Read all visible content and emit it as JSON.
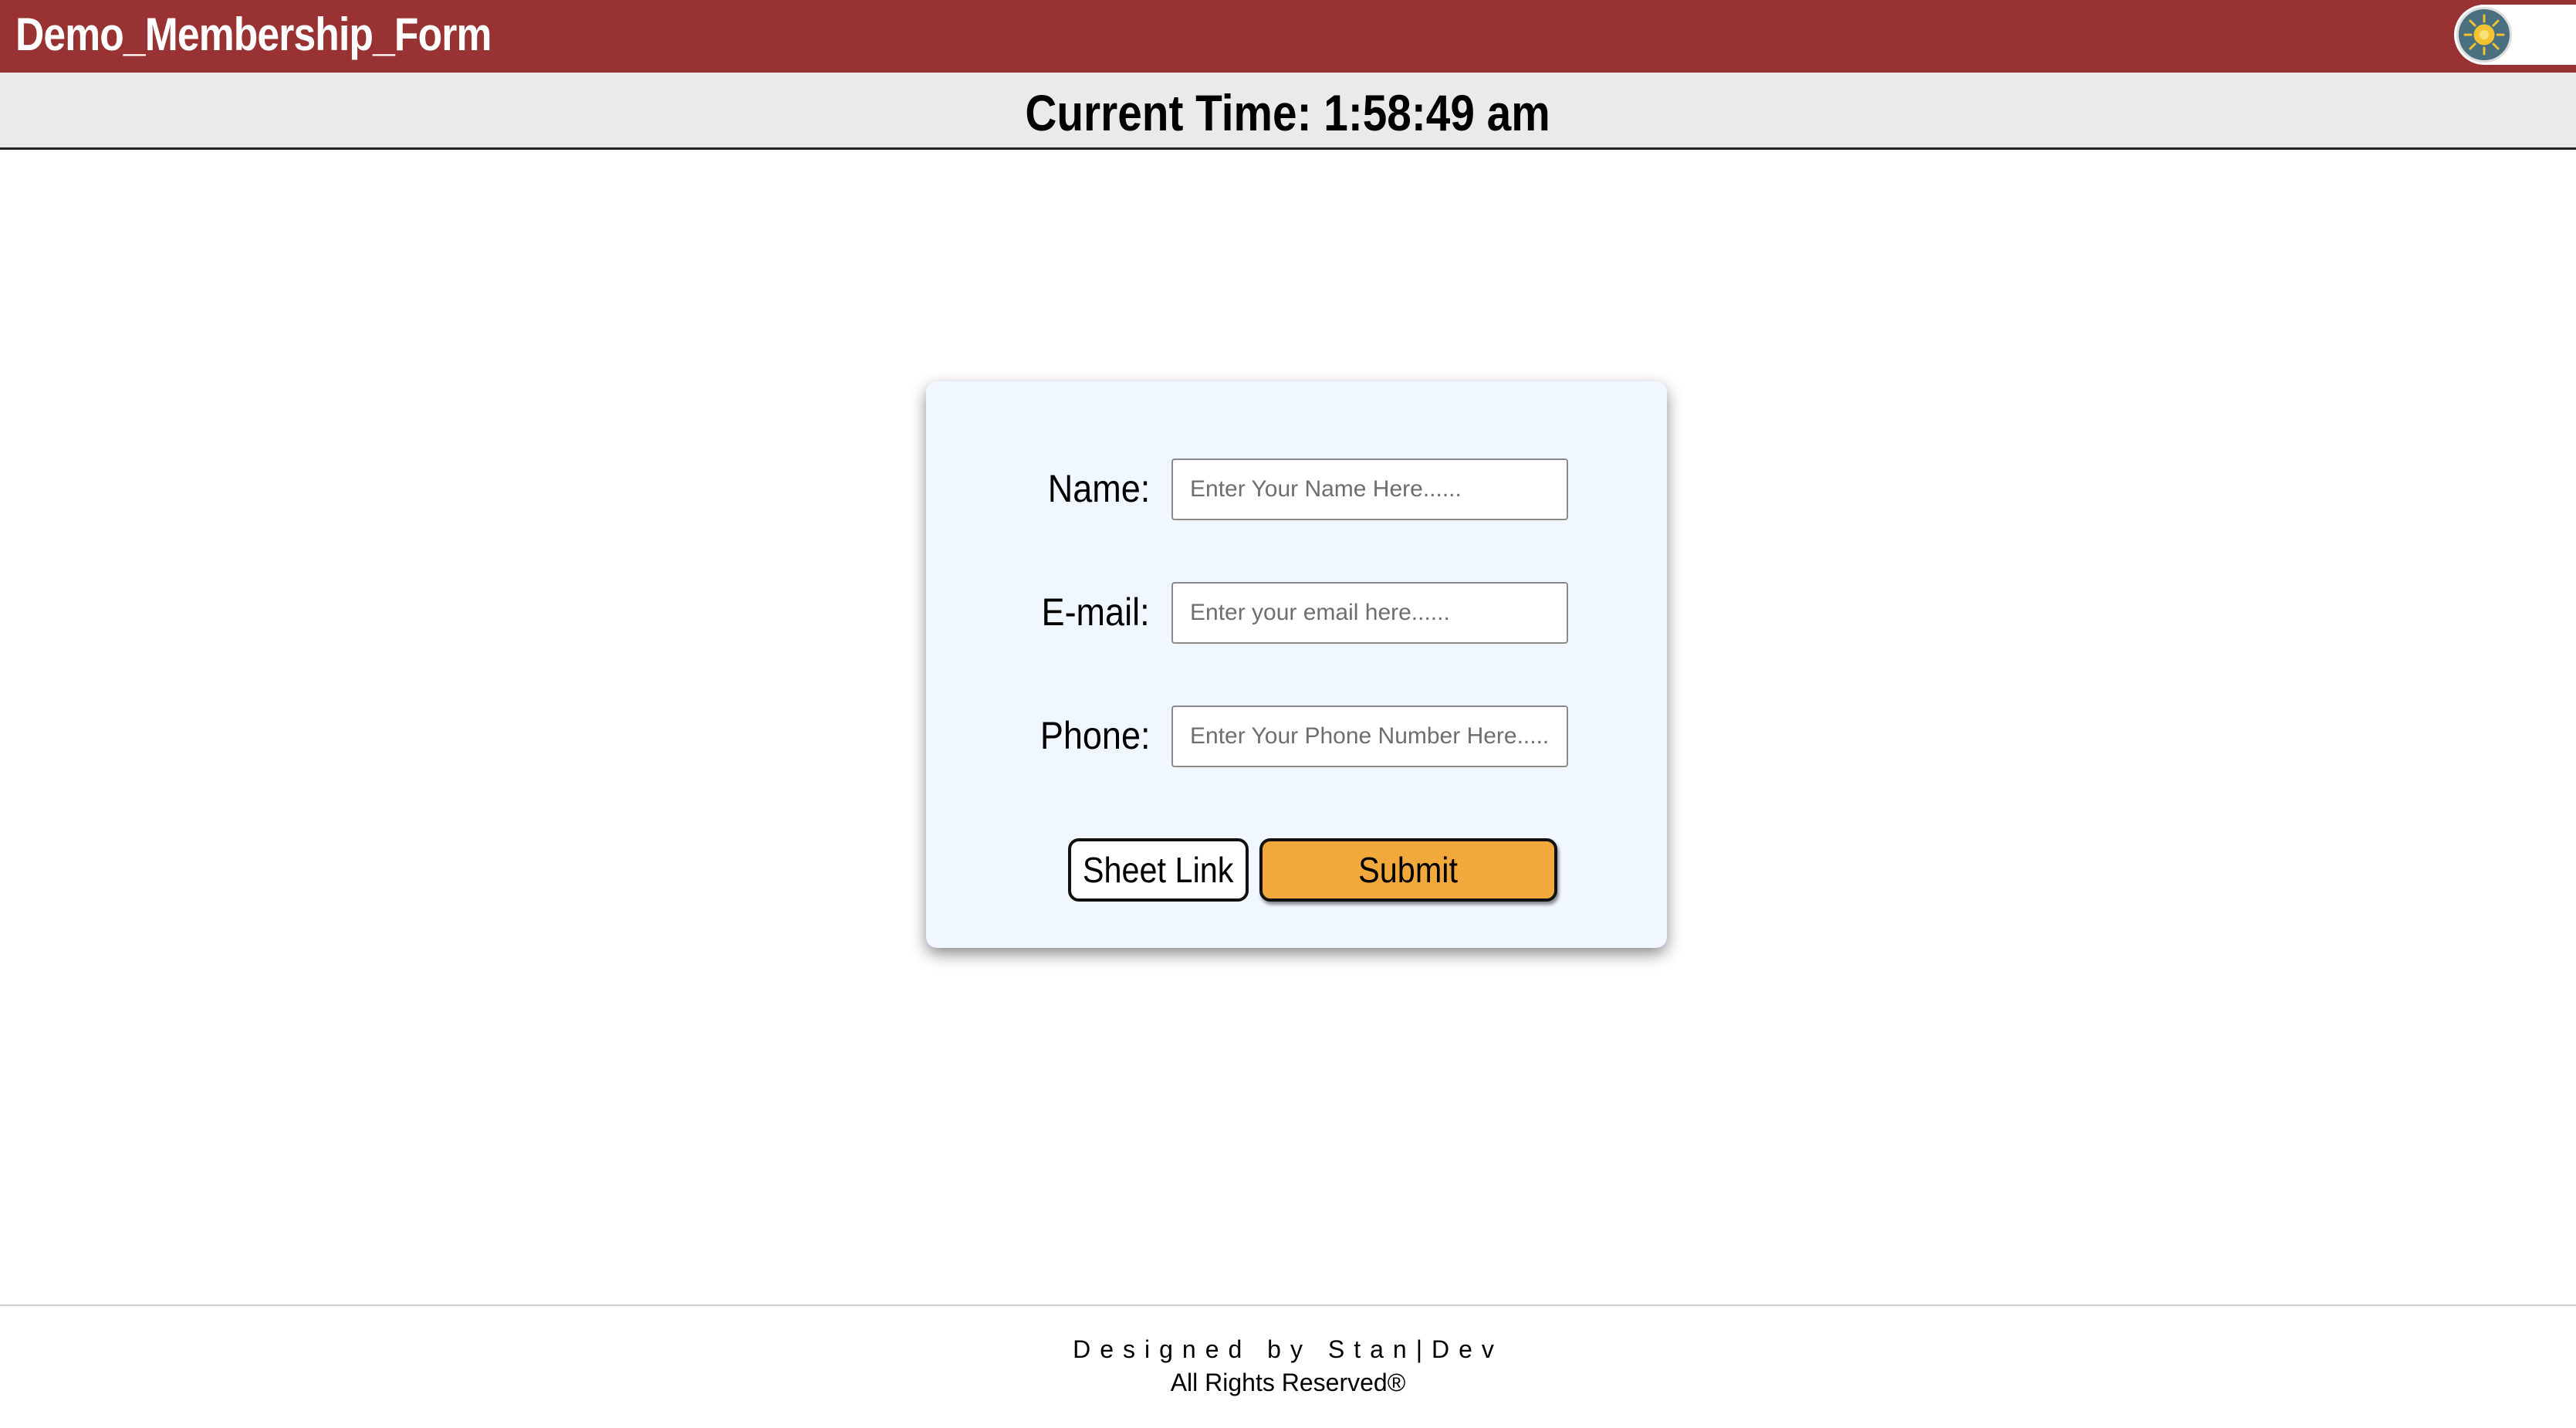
{
  "header": {
    "title": "Demo_Membership_Form",
    "theme_toggle_icon": "sun-icon",
    "theme_toggle_color": "#993232"
  },
  "time_bar": {
    "text": "Current Time: 1:58:49 am"
  },
  "form": {
    "fields": [
      {
        "label": "Name:",
        "placeholder": "Enter Your Name Here......",
        "value": ""
      },
      {
        "label": "E-mail:",
        "placeholder": "Enter your email here......",
        "value": ""
      },
      {
        "label": "Phone:",
        "placeholder": "Enter Your Phone Number Here......",
        "value": ""
      }
    ],
    "sheet_link_label": "Sheet Link",
    "submit_label": "Submit",
    "submit_color": "#f2a93b"
  },
  "footer": {
    "designed_by": "Designed by Stan|Dev",
    "rights": "All Rights Reserved®"
  }
}
